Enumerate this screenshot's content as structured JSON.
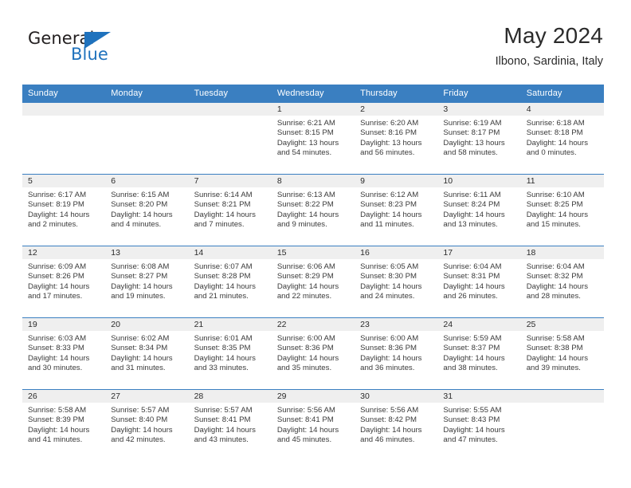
{
  "brand": {
    "name_top": "General",
    "name_bottom": "Blue",
    "accent_color": "#1f72bd",
    "header_color": "#3a7fc1"
  },
  "header": {
    "month_title": "May 2024",
    "location": "Ilbono, Sardinia, Italy"
  },
  "weekday_headers": [
    "Sunday",
    "Monday",
    "Tuesday",
    "Wednesday",
    "Thursday",
    "Friday",
    "Saturday"
  ],
  "weeks": [
    [
      {
        "day": "",
        "empty": true
      },
      {
        "day": "",
        "empty": true
      },
      {
        "day": "",
        "empty": true
      },
      {
        "day": "1",
        "sunrise": "Sunrise: 6:21 AM",
        "sunset": "Sunset: 8:15 PM",
        "daylight": "Daylight: 13 hours and 54 minutes."
      },
      {
        "day": "2",
        "sunrise": "Sunrise: 6:20 AM",
        "sunset": "Sunset: 8:16 PM",
        "daylight": "Daylight: 13 hours and 56 minutes."
      },
      {
        "day": "3",
        "sunrise": "Sunrise: 6:19 AM",
        "sunset": "Sunset: 8:17 PM",
        "daylight": "Daylight: 13 hours and 58 minutes."
      },
      {
        "day": "4",
        "sunrise": "Sunrise: 6:18 AM",
        "sunset": "Sunset: 8:18 PM",
        "daylight": "Daylight: 14 hours and 0 minutes."
      }
    ],
    [
      {
        "day": "5",
        "sunrise": "Sunrise: 6:17 AM",
        "sunset": "Sunset: 8:19 PM",
        "daylight": "Daylight: 14 hours and 2 minutes."
      },
      {
        "day": "6",
        "sunrise": "Sunrise: 6:15 AM",
        "sunset": "Sunset: 8:20 PM",
        "daylight": "Daylight: 14 hours and 4 minutes."
      },
      {
        "day": "7",
        "sunrise": "Sunrise: 6:14 AM",
        "sunset": "Sunset: 8:21 PM",
        "daylight": "Daylight: 14 hours and 7 minutes."
      },
      {
        "day": "8",
        "sunrise": "Sunrise: 6:13 AM",
        "sunset": "Sunset: 8:22 PM",
        "daylight": "Daylight: 14 hours and 9 minutes."
      },
      {
        "day": "9",
        "sunrise": "Sunrise: 6:12 AM",
        "sunset": "Sunset: 8:23 PM",
        "daylight": "Daylight: 14 hours and 11 minutes."
      },
      {
        "day": "10",
        "sunrise": "Sunrise: 6:11 AM",
        "sunset": "Sunset: 8:24 PM",
        "daylight": "Daylight: 14 hours and 13 minutes."
      },
      {
        "day": "11",
        "sunrise": "Sunrise: 6:10 AM",
        "sunset": "Sunset: 8:25 PM",
        "daylight": "Daylight: 14 hours and 15 minutes."
      }
    ],
    [
      {
        "day": "12",
        "sunrise": "Sunrise: 6:09 AM",
        "sunset": "Sunset: 8:26 PM",
        "daylight": "Daylight: 14 hours and 17 minutes."
      },
      {
        "day": "13",
        "sunrise": "Sunrise: 6:08 AM",
        "sunset": "Sunset: 8:27 PM",
        "daylight": "Daylight: 14 hours and 19 minutes."
      },
      {
        "day": "14",
        "sunrise": "Sunrise: 6:07 AM",
        "sunset": "Sunset: 8:28 PM",
        "daylight": "Daylight: 14 hours and 21 minutes."
      },
      {
        "day": "15",
        "sunrise": "Sunrise: 6:06 AM",
        "sunset": "Sunset: 8:29 PM",
        "daylight": "Daylight: 14 hours and 22 minutes."
      },
      {
        "day": "16",
        "sunrise": "Sunrise: 6:05 AM",
        "sunset": "Sunset: 8:30 PM",
        "daylight": "Daylight: 14 hours and 24 minutes."
      },
      {
        "day": "17",
        "sunrise": "Sunrise: 6:04 AM",
        "sunset": "Sunset: 8:31 PM",
        "daylight": "Daylight: 14 hours and 26 minutes."
      },
      {
        "day": "18",
        "sunrise": "Sunrise: 6:04 AM",
        "sunset": "Sunset: 8:32 PM",
        "daylight": "Daylight: 14 hours and 28 minutes."
      }
    ],
    [
      {
        "day": "19",
        "sunrise": "Sunrise: 6:03 AM",
        "sunset": "Sunset: 8:33 PM",
        "daylight": "Daylight: 14 hours and 30 minutes."
      },
      {
        "day": "20",
        "sunrise": "Sunrise: 6:02 AM",
        "sunset": "Sunset: 8:34 PM",
        "daylight": "Daylight: 14 hours and 31 minutes."
      },
      {
        "day": "21",
        "sunrise": "Sunrise: 6:01 AM",
        "sunset": "Sunset: 8:35 PM",
        "daylight": "Daylight: 14 hours and 33 minutes."
      },
      {
        "day": "22",
        "sunrise": "Sunrise: 6:00 AM",
        "sunset": "Sunset: 8:36 PM",
        "daylight": "Daylight: 14 hours and 35 minutes."
      },
      {
        "day": "23",
        "sunrise": "Sunrise: 6:00 AM",
        "sunset": "Sunset: 8:36 PM",
        "daylight": "Daylight: 14 hours and 36 minutes."
      },
      {
        "day": "24",
        "sunrise": "Sunrise: 5:59 AM",
        "sunset": "Sunset: 8:37 PM",
        "daylight": "Daylight: 14 hours and 38 minutes."
      },
      {
        "day": "25",
        "sunrise": "Sunrise: 5:58 AM",
        "sunset": "Sunset: 8:38 PM",
        "daylight": "Daylight: 14 hours and 39 minutes."
      }
    ],
    [
      {
        "day": "26",
        "sunrise": "Sunrise: 5:58 AM",
        "sunset": "Sunset: 8:39 PM",
        "daylight": "Daylight: 14 hours and 41 minutes."
      },
      {
        "day": "27",
        "sunrise": "Sunrise: 5:57 AM",
        "sunset": "Sunset: 8:40 PM",
        "daylight": "Daylight: 14 hours and 42 minutes."
      },
      {
        "day": "28",
        "sunrise": "Sunrise: 5:57 AM",
        "sunset": "Sunset: 8:41 PM",
        "daylight": "Daylight: 14 hours and 43 minutes."
      },
      {
        "day": "29",
        "sunrise": "Sunrise: 5:56 AM",
        "sunset": "Sunset: 8:41 PM",
        "daylight": "Daylight: 14 hours and 45 minutes."
      },
      {
        "day": "30",
        "sunrise": "Sunrise: 5:56 AM",
        "sunset": "Sunset: 8:42 PM",
        "daylight": "Daylight: 14 hours and 46 minutes."
      },
      {
        "day": "31",
        "sunrise": "Sunrise: 5:55 AM",
        "sunset": "Sunset: 8:43 PM",
        "daylight": "Daylight: 14 hours and 47 minutes."
      },
      {
        "day": "",
        "empty": true
      }
    ]
  ]
}
